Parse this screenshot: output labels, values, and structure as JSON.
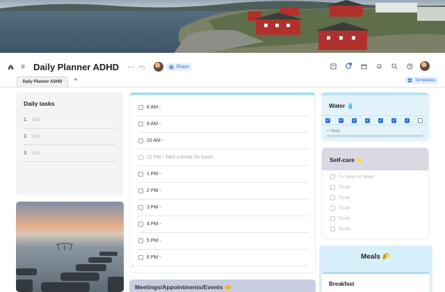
{
  "header": {
    "title": "Daily Planner ADHD",
    "share_label": "Share",
    "more": "···",
    "menu": "≡"
  },
  "tabs": {
    "active": "Daily Planner ADHD",
    "add": "+",
    "templates": "Templates"
  },
  "daily_tasks": {
    "title": "Daily tasks",
    "items": [
      {
        "num": "1.",
        "text": "List"
      },
      {
        "num": "2.",
        "text": "List"
      },
      {
        "num": "3.",
        "text": "List"
      }
    ]
  },
  "schedule": {
    "slots": [
      {
        "text": "8 AM -",
        "dim": false
      },
      {
        "text": "9 AM -",
        "dim": false
      },
      {
        "text": "10 AM -",
        "dim": false
      },
      {
        "text": "12 PM - Take a break for lunch",
        "dim": true
      },
      {
        "text": "1 PM -",
        "dim": false
      },
      {
        "text": "2 PM -",
        "dim": false
      },
      {
        "text": "3 PM -",
        "dim": false
      },
      {
        "text": "4 PM -",
        "dim": false
      },
      {
        "text": "5 PM -",
        "dim": false
      },
      {
        "text": "6 PM -",
        "dim": false
      }
    ]
  },
  "meetings": {
    "title": "Meetings/Appointments/Events 🤝"
  },
  "water": {
    "title": "Water 💧",
    "checked": [
      true,
      true,
      true,
      true,
      true,
      true,
      true,
      false
    ],
    "new_label": "+ New"
  },
  "selfcare": {
    "title": "Self-care ⭐",
    "items": [
      "7+ hours of sleep",
      "To-do",
      "To-do",
      "To-do",
      "To-do",
      "To-do"
    ]
  },
  "meals": {
    "title": "Meals 🌮",
    "breakfast": "Breakfast"
  },
  "colors": {
    "accent": "#2f6fd6",
    "water_bg": "#e3f3fb",
    "sched_bar": "#a9def0"
  }
}
